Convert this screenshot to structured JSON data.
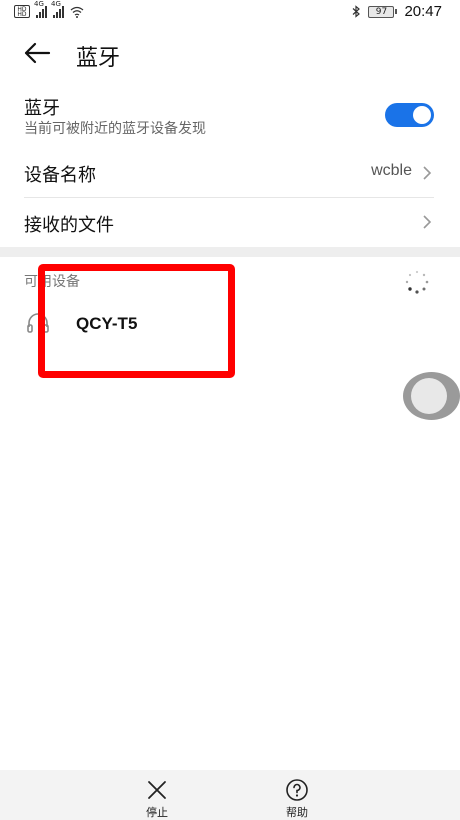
{
  "status_bar": {
    "signal_1_label": "4G",
    "signal_2_label": "4G",
    "battery": "97",
    "time": "20:47"
  },
  "app_bar": {
    "title": "蓝牙"
  },
  "bluetooth": {
    "title": "蓝牙",
    "subtitle": "当前可被附近的蓝牙设备发现",
    "enabled": true
  },
  "device_name_row": {
    "label": "设备名称",
    "value": "wcble"
  },
  "received_files_row": {
    "label": "接收的文件"
  },
  "available_devices": {
    "header": "可用设备",
    "devices": [
      {
        "name": "QCY-T5",
        "icon": "headphones-icon"
      }
    ]
  },
  "bottom_bar": {
    "stop_label": "停止",
    "help_label": "帮助"
  },
  "colors": {
    "accent": "#1a73e8",
    "highlight": "#ff0000"
  }
}
